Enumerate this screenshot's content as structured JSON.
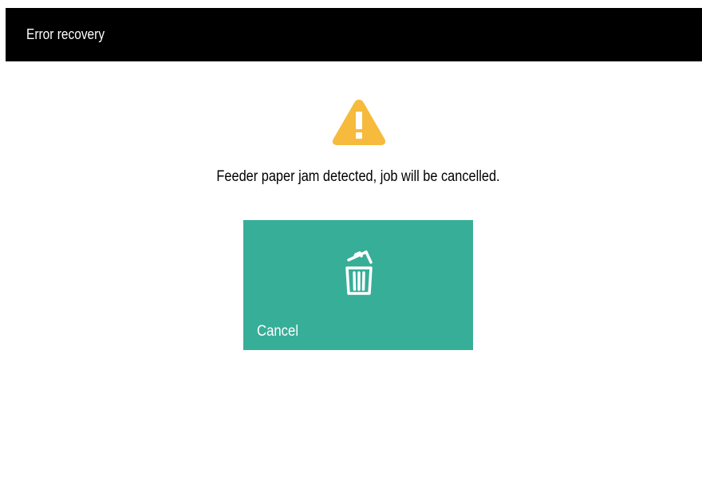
{
  "header": {
    "title": "Error recovery"
  },
  "alert": {
    "icon": "warning-triangle-icon",
    "icon_color": "#f6bb3c",
    "message": "Feeder paper jam detected, job will be cancelled."
  },
  "actions": {
    "cancel": {
      "label": "Cancel",
      "icon": "trash-icon",
      "background": "#37ae98"
    }
  }
}
